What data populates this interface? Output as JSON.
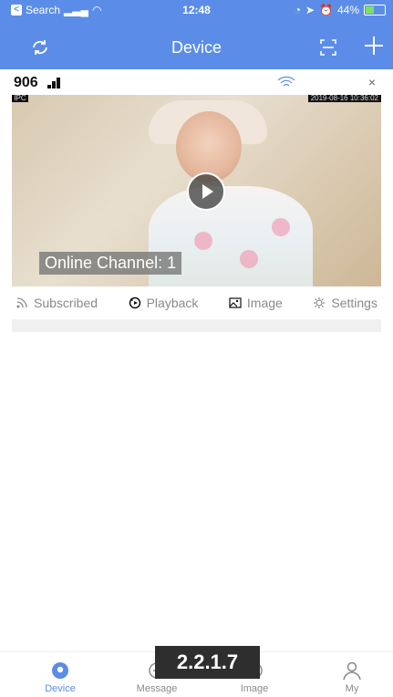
{
  "status": {
    "carrier": "Search",
    "time": "12:48",
    "battery": "44%"
  },
  "header": {
    "title": "Device"
  },
  "device": {
    "name": "906",
    "video": {
      "corner_label": "IPC",
      "timestamp": "2019-08-16 10:36:02",
      "online_text": "Online Channel: 1"
    }
  },
  "actions": {
    "subscribed": "Subscribed",
    "playback": "Playback",
    "image": "Image",
    "settings": "Settings"
  },
  "tabs": [
    {
      "label": "Device"
    },
    {
      "label": "Message"
    },
    {
      "label": "Image"
    },
    {
      "label": "My"
    }
  ],
  "version": "2.2.1.7",
  "colors": {
    "accent": "#5b8de8"
  }
}
